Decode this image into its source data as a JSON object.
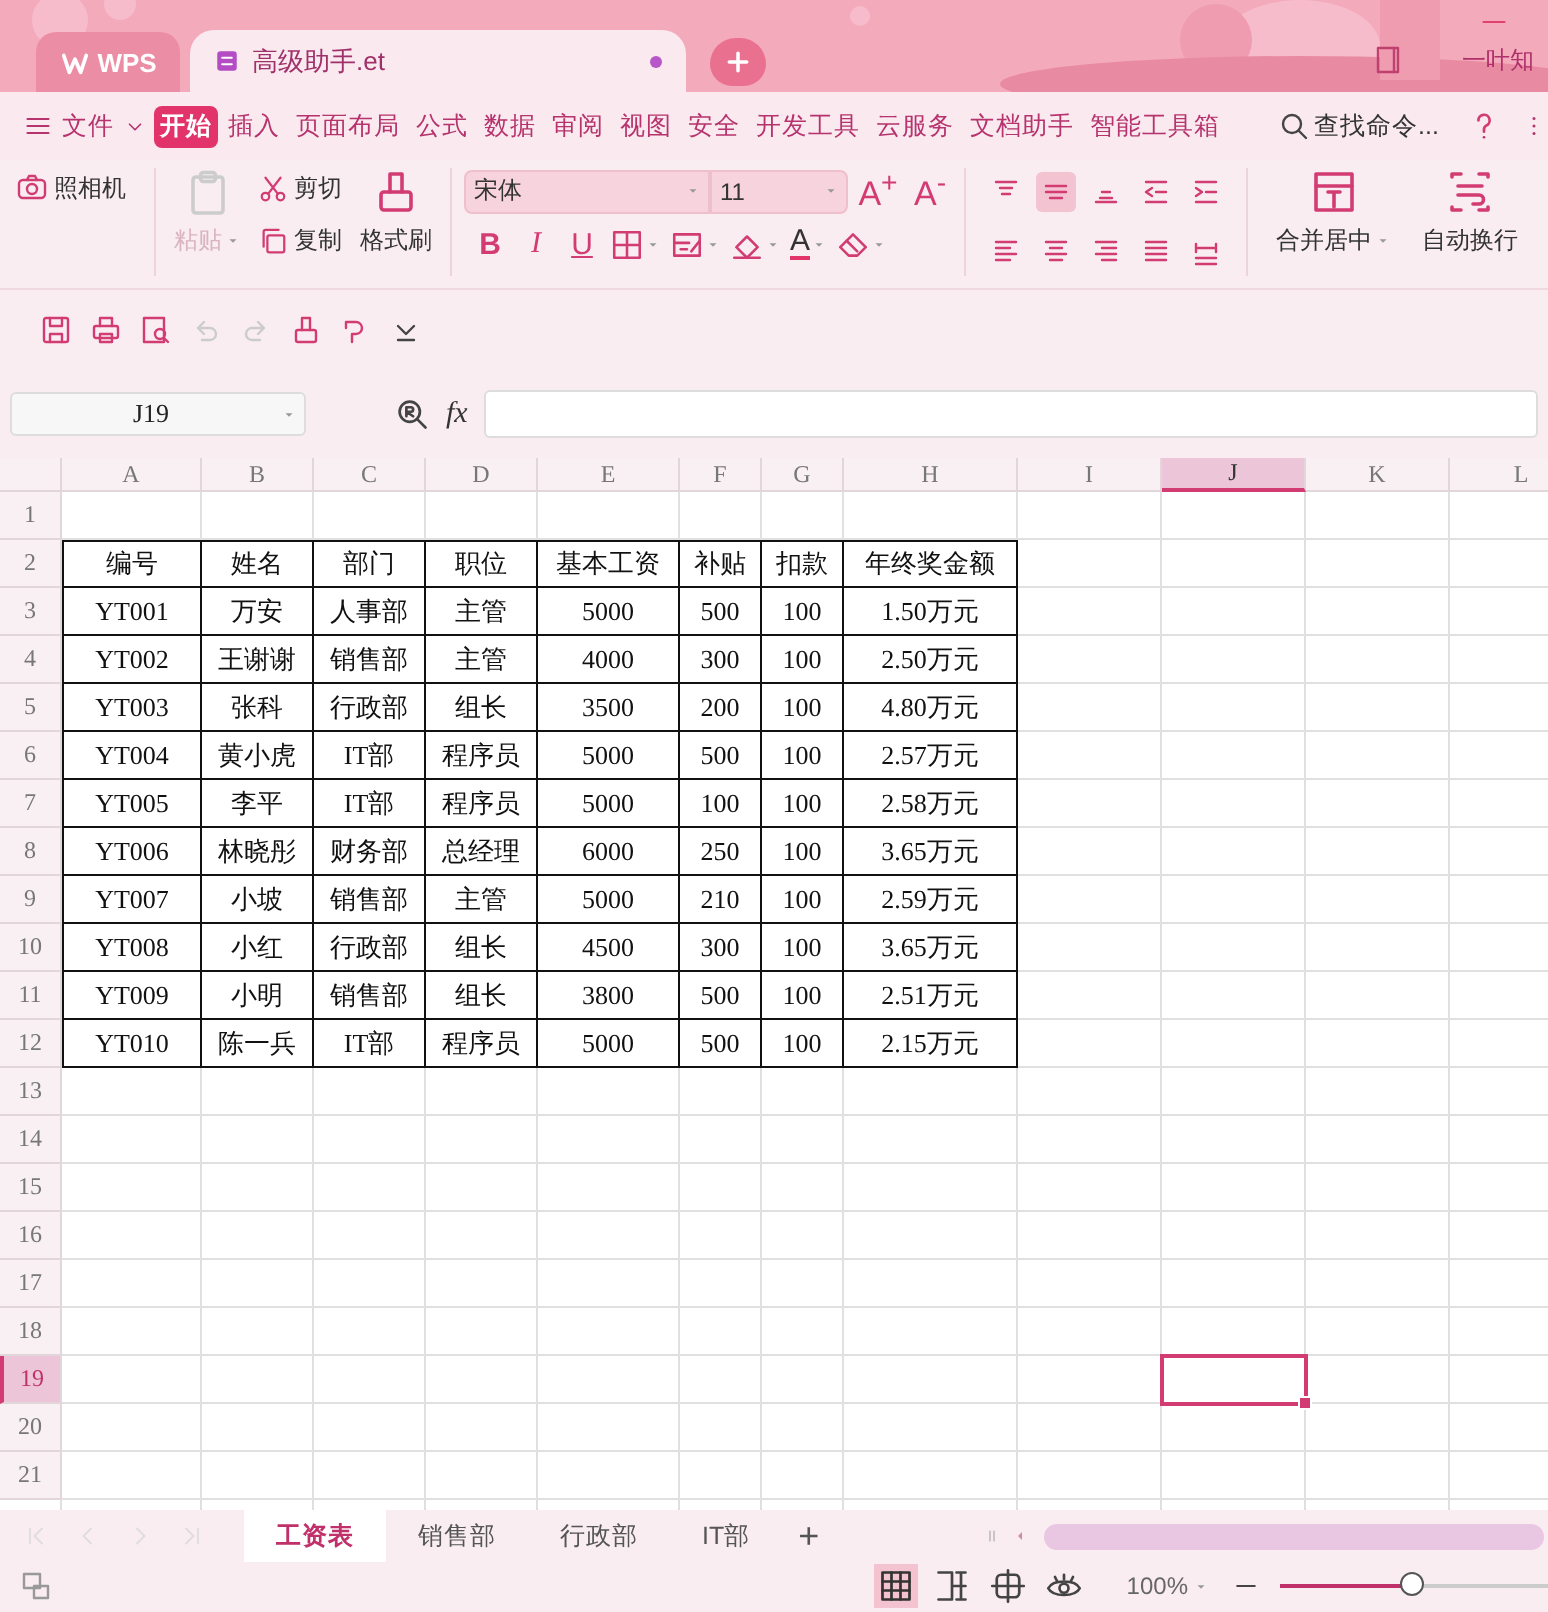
{
  "title_bar": {
    "app_tab": "WPS",
    "document_tab": {
      "title": "高级助手.et",
      "selected": true
    },
    "user": "一叶知"
  },
  "menu": {
    "file": "文件",
    "tabs": [
      {
        "label": "开始",
        "selected": true
      },
      {
        "label": "插入",
        "selected": false
      },
      {
        "label": "页面布局",
        "selected": false
      },
      {
        "label": "公式",
        "selected": false
      },
      {
        "label": "数据",
        "selected": false
      },
      {
        "label": "审阅",
        "selected": false
      },
      {
        "label": "视图",
        "selected": false
      },
      {
        "label": "安全",
        "selected": false
      },
      {
        "label": "开发工具",
        "selected": false
      },
      {
        "label": "云服务",
        "selected": false
      },
      {
        "label": "文档助手",
        "selected": false
      },
      {
        "label": "智能工具箱",
        "selected": false
      }
    ],
    "search": "查找命令..."
  },
  "ribbon": {
    "camera": "照相机",
    "paste": {
      "label": "粘贴",
      "disabled": true
    },
    "cut": "剪切",
    "copy": "复制",
    "format_painter": "格式刷",
    "font_name": "宋体",
    "font_size": "11",
    "size_buttons": [
      "A$^{+}$",
      "A$^{-}$"
    ],
    "format_buttons": [
      {
        "kind": "bold",
        "label": "B"
      },
      {
        "kind": "italic",
        "label": "I"
      },
      {
        "kind": "underline",
        "label": "U"
      }
    ],
    "font_color": "A",
    "alignment": [
      {
        "kind": "top",
        "selected": false
      },
      {
        "kind": "middle",
        "selected": true
      },
      {
        "kind": "bottom",
        "selected": false
      },
      {
        "kind": "outdent",
        "selected": false
      },
      {
        "kind": "indent",
        "selected": false
      },
      {
        "kind": "left",
        "selected": false
      },
      {
        "kind": "center",
        "selected": false
      },
      {
        "kind": "right",
        "selected": false
      },
      {
        "kind": "justify",
        "selected": false
      },
      {
        "kind": "distribute",
        "selected": false
      }
    ],
    "merge": "合并居中",
    "wrap": "自动换行"
  },
  "quick_toolbar": [
    {
      "kind": "save",
      "disabled": false
    },
    {
      "kind": "print",
      "disabled": false
    },
    {
      "kind": "preview",
      "disabled": false
    },
    {
      "kind": "undo",
      "disabled": true
    },
    {
      "kind": "redo",
      "disabled": true
    },
    {
      "kind": "brush",
      "disabled": false
    },
    {
      "kind": "macro",
      "disabled": false
    },
    {
      "kind": "more",
      "disabled": false
    }
  ],
  "formula_bar": {
    "name_box": "J19",
    "function_label": "fx"
  },
  "sheet": {
    "columns": [
      {
        "label": "A",
        "selected": false
      },
      {
        "label": "B",
        "selected": false
      },
      {
        "label": "C",
        "selected": false
      },
      {
        "label": "D",
        "selected": false
      },
      {
        "label": "E",
        "selected": false
      },
      {
        "label": "F",
        "selected": false
      },
      {
        "label": "G",
        "selected": false
      },
      {
        "label": "H",
        "selected": false
      },
      {
        "label": "I",
        "selected": false
      },
      {
        "label": "J",
        "selected": true
      },
      {
        "label": "K",
        "selected": false
      },
      {
        "label": "L",
        "selected": false
      }
    ],
    "rows": [
      {
        "number": "1",
        "selected": false,
        "bordered": false
      },
      {
        "number": "2",
        "selected": false,
        "bordered": true,
        "cells": [
          "编号",
          "姓名",
          "部门",
          "职位",
          "基本工资",
          "补贴",
          "扣款",
          "年终奖金额"
        ]
      },
      {
        "number": "3",
        "selected": false,
        "bordered": true,
        "cells": [
          "YT001",
          "万安",
          "人事部",
          "主管",
          "5000",
          "500",
          "100",
          "1.50万元"
        ]
      },
      {
        "number": "4",
        "selected": false,
        "bordered": true,
        "cells": [
          "YT002",
          "王谢谢",
          "销售部",
          "主管",
          "4000",
          "300",
          "100",
          "2.50万元"
        ]
      },
      {
        "number": "5",
        "selected": false,
        "bordered": true,
        "cells": [
          "YT003",
          "张科",
          "行政部",
          "组长",
          "3500",
          "200",
          "100",
          "4.80万元"
        ]
      },
      {
        "number": "6",
        "selected": false,
        "bordered": true,
        "cells": [
          "YT004",
          "黄小虎",
          "IT部",
          "程序员",
          "5000",
          "500",
          "100",
          "2.57万元"
        ]
      },
      {
        "number": "7",
        "selected": false,
        "bordered": true,
        "cells": [
          "YT005",
          "李平",
          "IT部",
          "程序员",
          "5000",
          "100",
          "100",
          "2.58万元"
        ]
      },
      {
        "number": "8",
        "selected": false,
        "bordered": true,
        "cells": [
          "YT006",
          "林晓彤",
          "财务部",
          "总经理",
          "6000",
          "250",
          "100",
          "3.65万元"
        ]
      },
      {
        "number": "9",
        "selected": false,
        "bordered": true,
        "cells": [
          "YT007",
          "小坡",
          "销售部",
          "主管",
          "5000",
          "210",
          "100",
          "2.59万元"
        ]
      },
      {
        "number": "10",
        "selected": false,
        "bordered": true,
        "cells": [
          "YT008",
          "小红",
          "行政部",
          "组长",
          "4500",
          "300",
          "100",
          "3.65万元"
        ]
      },
      {
        "number": "11",
        "selected": false,
        "bordered": true,
        "cells": [
          "YT009",
          "小明",
          "销售部",
          "组长",
          "3800",
          "500",
          "100",
          "2.51万元"
        ]
      },
      {
        "number": "12",
        "selected": false,
        "bordered": true,
        "cells": [
          "YT010",
          "陈一兵",
          "IT部",
          "程序员",
          "5000",
          "500",
          "100",
          "2.15万元"
        ]
      },
      {
        "number": "13",
        "selected": false,
        "bordered": false
      },
      {
        "number": "14",
        "selected": false,
        "bordered": false
      },
      {
        "number": "15",
        "selected": false,
        "bordered": false
      },
      {
        "number": "16",
        "selected": false,
        "bordered": false
      },
      {
        "number": "17",
        "selected": false,
        "bordered": false
      },
      {
        "number": "18",
        "selected": false,
        "bordered": false
      },
      {
        "number": "19",
        "selected": true,
        "bordered": false
      },
      {
        "number": "20",
        "selected": false,
        "bordered": false
      },
      {
        "number": "21",
        "selected": false,
        "bordered": false
      }
    ]
  },
  "sheet_tabs": {
    "nav": [
      {
        "kind": "first",
        "disabled": true
      },
      {
        "kind": "prev",
        "disabled": true
      },
      {
        "kind": "next",
        "disabled": true
      },
      {
        "kind": "last",
        "disabled": true
      }
    ],
    "tabs": [
      {
        "label": "工资表",
        "selected": true
      },
      {
        "label": "销售部",
        "selected": false
      },
      {
        "label": "行政部",
        "selected": false
      },
      {
        "label": "IT部",
        "selected": false
      }
    ],
    "add": "+"
  },
  "status_bar": {
    "view_modes": [
      {
        "kind": "normal",
        "selected": true
      },
      {
        "kind": "pagebreak",
        "selected": false
      },
      {
        "kind": "layout",
        "selected": false
      },
      {
        "kind": "eye",
        "selected": false
      }
    ],
    "zoom": "100%",
    "zoom_slider": {
      "level": 0.5
    }
  }
}
